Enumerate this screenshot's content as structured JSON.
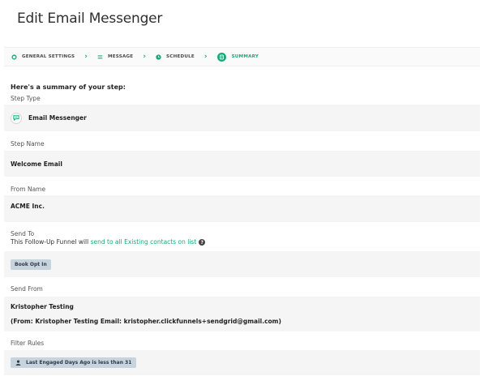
{
  "page_title": "Edit Email Messenger",
  "colors": {
    "accent": "#1aa978",
    "badge_bg": "#c7d3dd",
    "row_bg": "#f5f5f5"
  },
  "stepper": {
    "steps": [
      {
        "label": "GENERAL SETTINGS",
        "icon": "gear-icon"
      },
      {
        "label": "MESSAGE",
        "icon": "lines-icon"
      },
      {
        "label": "SCHEDULE",
        "icon": "clock-icon"
      },
      {
        "label": "SUMMARY",
        "icon": "checklist-icon",
        "active": true
      }
    ],
    "separator": "›"
  },
  "summary": {
    "intro": "Here's a summary of your step:",
    "step_type": {
      "label": "Step Type",
      "value": "Email Messenger",
      "icon": "message-icon"
    },
    "step_name": {
      "label": "Step Name",
      "value": "Welcome Email"
    },
    "from_name": {
      "label": "From Name",
      "value": "ACME Inc."
    },
    "send_to": {
      "label": "Send To",
      "text_prefix": "This Follow-Up Funnel will ",
      "link_text": "send to all Existing contacts on list",
      "help": "?",
      "tag": "Book Opt In"
    },
    "send_from": {
      "label": "Send From",
      "name": "Kristopher Testing",
      "detail": "(From: Kristopher Testing Email: kristopher.clickfunnels+sendgrid@gmail.com)"
    },
    "filter_rules": {
      "label": "Filter Rules",
      "rule": "Last Engaged Days Ago is less than 31",
      "icon": "user-icon"
    }
  }
}
